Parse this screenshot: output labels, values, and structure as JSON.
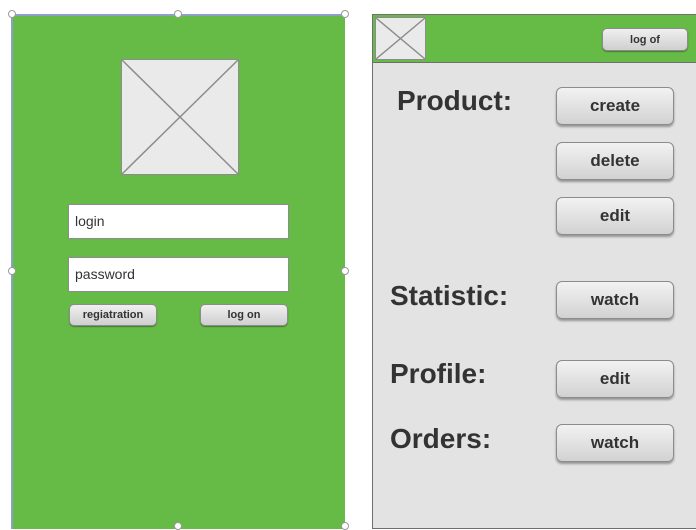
{
  "login_screen": {
    "login_placeholder": "login",
    "password_placeholder": "password",
    "registration_label": "regiatration",
    "logon_label": "log on"
  },
  "admin_screen": {
    "logoff_label": "log of",
    "product": {
      "label": "Product:",
      "create": "create",
      "delete": "delete",
      "edit": "edit"
    },
    "statistic": {
      "label": "Statistic:",
      "watch": "watch"
    },
    "profile": {
      "label": "Profile:",
      "edit": "edit"
    },
    "orders": {
      "label": "Orders:",
      "watch": "watch"
    }
  },
  "colors": {
    "accent_green": "#65bb46",
    "panel_gray": "#e3e3e3",
    "button_gray": "#dcdcdc",
    "text_dark": "#333333"
  },
  "icons": [
    "image-placeholder-icon",
    "selection-handle-icon"
  ]
}
